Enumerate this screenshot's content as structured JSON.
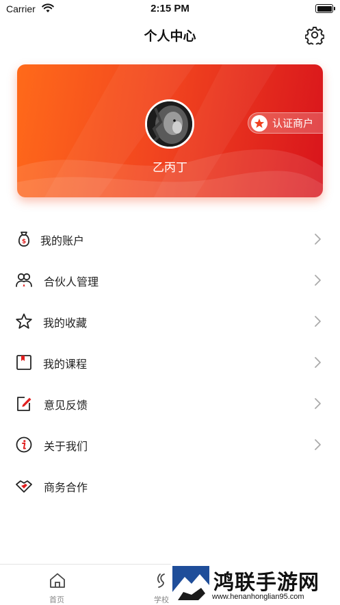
{
  "status_bar": {
    "carrier": "Carrier",
    "time": "2:15 PM"
  },
  "nav": {
    "title": "个人中心",
    "settings_icon": "gear-icon"
  },
  "profile": {
    "username": "乙丙丁",
    "badge_label": "认证商户",
    "badge_icon": "star-icon",
    "avatar": "lion-avatar"
  },
  "menu": [
    {
      "label": "我的账户",
      "icon": "money-bag-icon",
      "has_arrow": true
    },
    {
      "label": "合伙人管理",
      "icon": "partners-icon",
      "has_arrow": true
    },
    {
      "label": "我的收藏",
      "icon": "star-outline-icon",
      "has_arrow": true
    },
    {
      "label": "我的课程",
      "icon": "course-book-icon",
      "has_arrow": true
    },
    {
      "label": "意见反馈",
      "icon": "feedback-edit-icon",
      "has_arrow": true
    },
    {
      "label": "关于我们",
      "icon": "info-icon",
      "has_arrow": true
    },
    {
      "label": "商务合作",
      "icon": "handshake-icon",
      "has_arrow": false
    }
  ],
  "tabs": [
    {
      "label": "首页",
      "icon": "home-icon"
    },
    {
      "label": "学校",
      "icon": "school-icon"
    }
  ],
  "watermark": {
    "text": "鸿联手游网",
    "url": "www.henanhonglian95.com"
  },
  "colors": {
    "accent": "#f2461f",
    "accent_dark": "#d8141c",
    "icon_red": "#e02020"
  }
}
